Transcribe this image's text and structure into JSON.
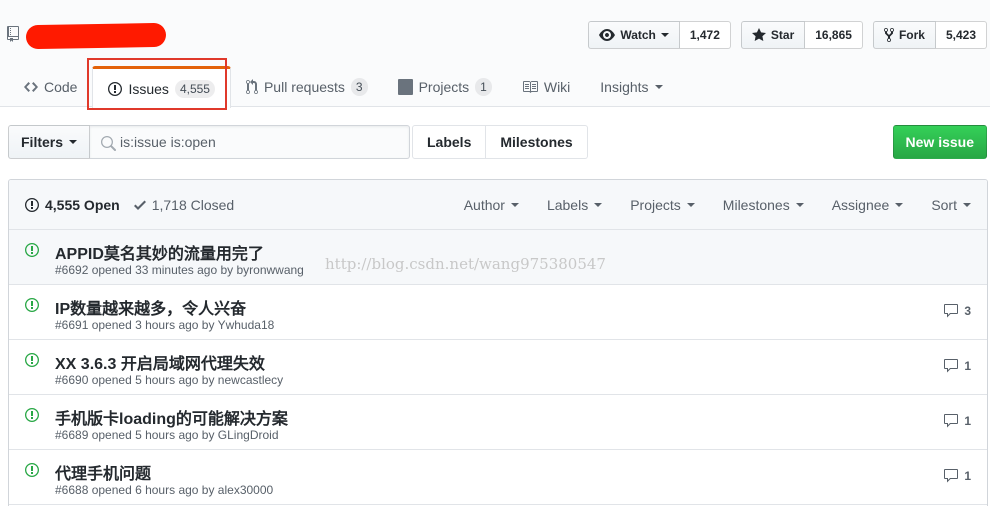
{
  "header": {
    "watch": {
      "label": "Watch",
      "count": "1,472"
    },
    "star": {
      "label": "Star",
      "count": "16,865"
    },
    "fork": {
      "label": "Fork",
      "count": "5,423"
    }
  },
  "tabs": [
    {
      "label": "Code",
      "icon": "code-icon"
    },
    {
      "label": "Issues",
      "icon": "issue-opened-icon",
      "badge": "4,555"
    },
    {
      "label": "Pull requests",
      "icon": "pull-request-icon",
      "badge": "3"
    },
    {
      "label": "Projects",
      "icon": "project-icon",
      "badge": "1"
    },
    {
      "label": "Wiki",
      "icon": "book-icon"
    },
    {
      "label": "Insights",
      "icon": "chevron-down-icon"
    }
  ],
  "filter": {
    "filters_label": "Filters",
    "search_value": "is:issue is:open",
    "labels_label": "Labels",
    "milestones_label": "Milestones",
    "new_issue_label": "New issue"
  },
  "states": {
    "open": "4,555 Open",
    "closed": "1,718 Closed"
  },
  "toolbar": [
    "Author",
    "Labels",
    "Projects",
    "Milestones",
    "Assignee",
    "Sort"
  ],
  "issues": [
    {
      "title": "APPID莫名其妙的流量用完了",
      "meta": "#6692 opened 33 minutes ago by byronwwang",
      "comments": ""
    },
    {
      "title": "IP数量越来越多，令人兴奋",
      "meta": "#6691 opened 3 hours ago by Ywhuda18",
      "comments": "3"
    },
    {
      "title": "XX 3.6.3 开启局域网代理失效",
      "meta": "#6690 opened 5 hours ago by newcastlecy",
      "comments": "1"
    },
    {
      "title": "手机版卡loading的可能解决方案",
      "meta": "#6689 opened 5 hours ago by GLingDroid",
      "comments": "1"
    },
    {
      "title": "代理手机问题",
      "meta": "#6688 opened 6 hours ago by alex30000",
      "comments": "1"
    }
  ],
  "watermark": "http://blog.csdn.net/wang975380547",
  "colors": {
    "accent_tab": "#e36209",
    "open_green": "#28a745",
    "highlight_red": "#e0392b",
    "redaction": "#ff1a00"
  }
}
